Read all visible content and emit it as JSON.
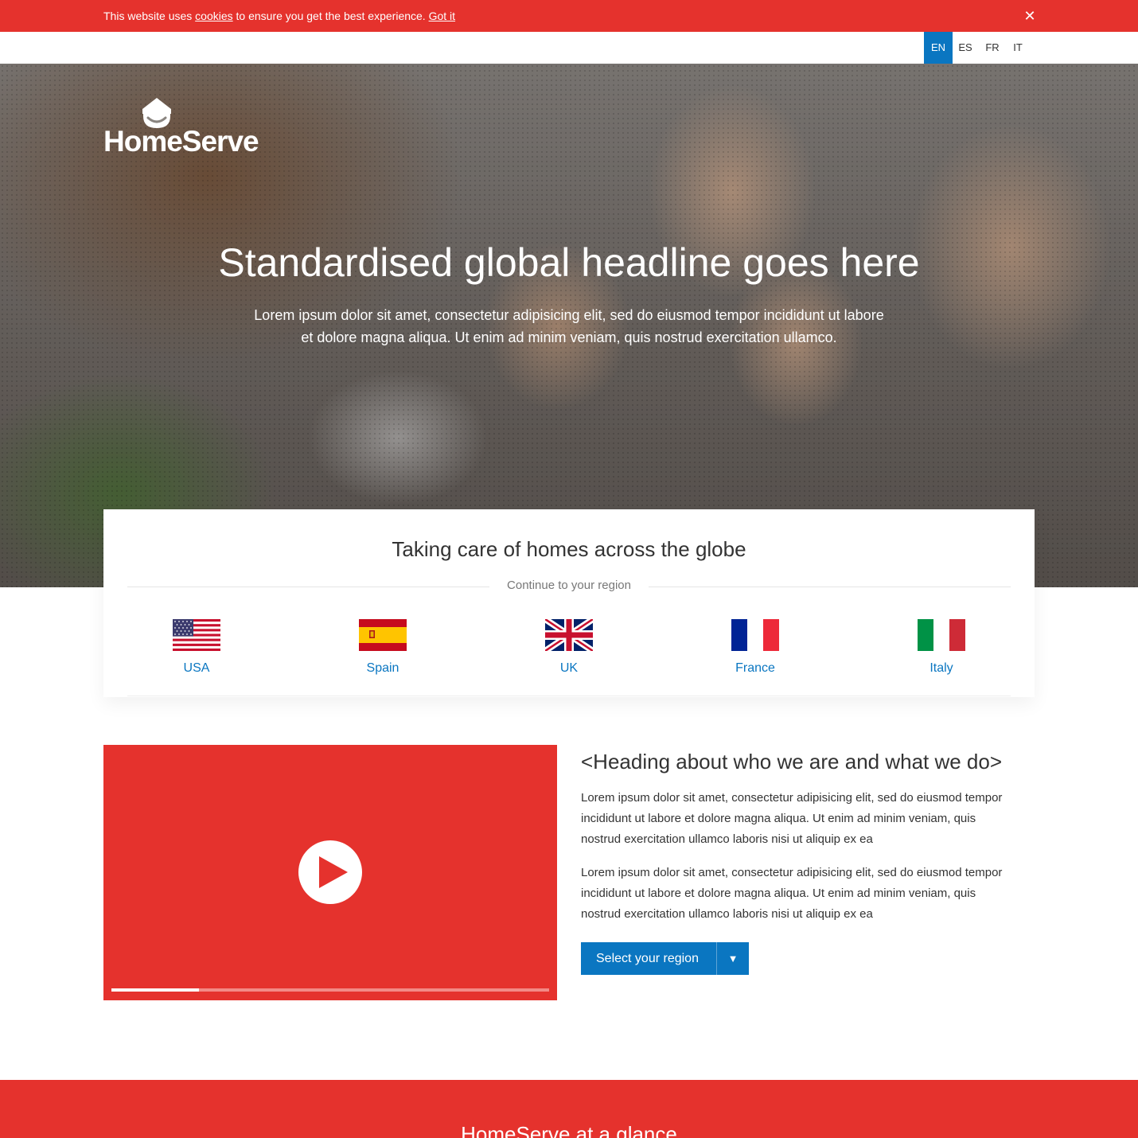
{
  "cookie_bar": {
    "text_before": "This website uses ",
    "link": "cookies",
    "text_after": " to ensure you get the best experience. ",
    "accept": "Got it",
    "close": "✕"
  },
  "languages": [
    "EN",
    "ES",
    "FR",
    "IT"
  ],
  "active_language": "EN",
  "logo": {
    "text": "HomeServe"
  },
  "hero": {
    "title": "Standardised global headline goes here",
    "subtitle": "Lorem ipsum dolor sit amet, consectetur adipisicing elit, sed do eiusmod tempor incididunt ut labore et dolore magna aliqua. Ut enim ad minim veniam, quis nostrud exercitation ullamco."
  },
  "regions": {
    "title": "Taking care of homes across the globe",
    "subtitle": "Continue to your region",
    "countries": [
      {
        "name": "USA",
        "flag": "us-flag-icon"
      },
      {
        "name": "Spain",
        "flag": "spain-flag-icon"
      },
      {
        "name": "UK",
        "flag": "uk-flag-icon"
      },
      {
        "name": "France",
        "flag": "france-flag-icon"
      },
      {
        "name": "Italy",
        "flag": "italy-flag-icon"
      }
    ]
  },
  "video": {
    "progress_fraction": 0.2,
    "icon": "play-icon"
  },
  "about": {
    "heading": "<Heading about who we are and what we do>",
    "paragraphs": [
      "Lorem ipsum dolor sit amet, consectetur adipisicing elit, sed do eiusmod tempor incididunt ut labore et dolore magna aliqua. Ut enim ad minim veniam, quis nostrud exercitation ullamco laboris nisi ut aliquip ex ea",
      "Lorem ipsum dolor sit amet, consectetur adipisicing elit, sed do eiusmod tempor incididunt ut labore et dolore magna aliqua. Ut enim ad minim veniam, quis nostrud exercitation ullamco laboris nisi ut aliquip ex ea"
    ],
    "select_label": "Select your region",
    "select_arrow": "▼"
  },
  "glance": {
    "title": "HomeServe at a glance"
  },
  "colors": {
    "brand_red": "#e5322d",
    "accent_blue": "#0a76c1"
  }
}
